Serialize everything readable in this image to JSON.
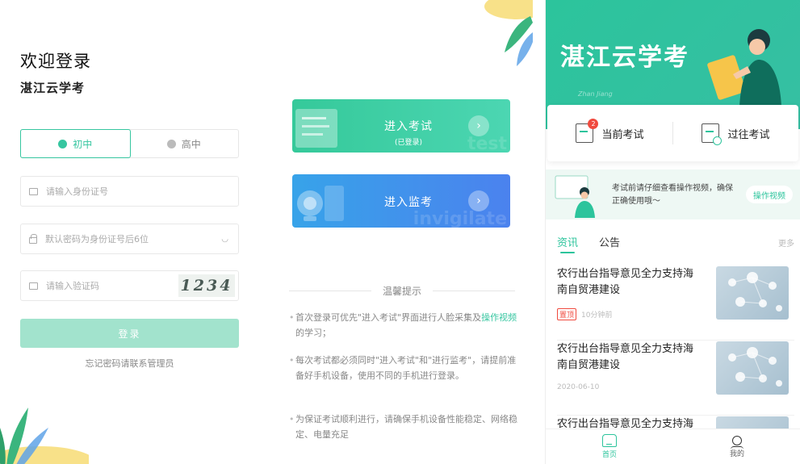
{
  "login": {
    "title": "欢迎登录",
    "app_name": "湛江云学考",
    "grades": [
      "初中",
      "高中"
    ],
    "id_placeholder": "请输入身份证号",
    "password_placeholder": "默认密码为身份证号后6位",
    "captcha_placeholder": "请输入验证码",
    "captcha_text": "1234",
    "login_button": "登录",
    "forgot_text": "忘记密码请联系管理员"
  },
  "entry": {
    "exam_card": {
      "title": "进入考试",
      "subtitle": "(已登录)",
      "watermark": "test"
    },
    "proctor_card": {
      "title": "进入监考",
      "watermark": "invigilate"
    },
    "tips_heading": "温馨提示",
    "tips": [
      {
        "text": "首次登录可优先\"进入考试\"界面进行人脸采集及",
        "link": "操作视频",
        "text_after": "的学习；"
      },
      {
        "text": "每次考试都必须同时\"进入考试\"和\"进行监考\"，请提前准备好手机设备，使用不同的手机进行登录。"
      },
      {
        "text": "为保证考试顺利进行，请确保手机设备性能稳定、网络稳定、电量充足"
      }
    ]
  },
  "home": {
    "hero_title": "湛江云学考",
    "hero_deco": "Zhan Jiang",
    "current_exam": "当前考试",
    "current_exam_badge": "2",
    "past_exam": "过往考试",
    "notice_text": "考试前请仔细查看操作视频，确保正确使用哦～",
    "notice_button": "操作视频",
    "tabs": [
      "资讯",
      "公告"
    ],
    "more": "更多",
    "news": [
      {
        "title": "农行出台指导意见全力支持海南自贸港建设",
        "pinned": "置顶",
        "meta": "10分钟前"
      },
      {
        "title": "农行出台指导意见全力支持海南自贸港建设",
        "meta": "2020-06-10"
      },
      {
        "title": "农行出台指导意见全力支持海"
      }
    ],
    "nav": [
      "首页",
      "我的"
    ]
  },
  "colors": {
    "accent": "#36c6a0",
    "proctor_blue": "#4b82ee",
    "badge_red": "#f04a3e"
  }
}
